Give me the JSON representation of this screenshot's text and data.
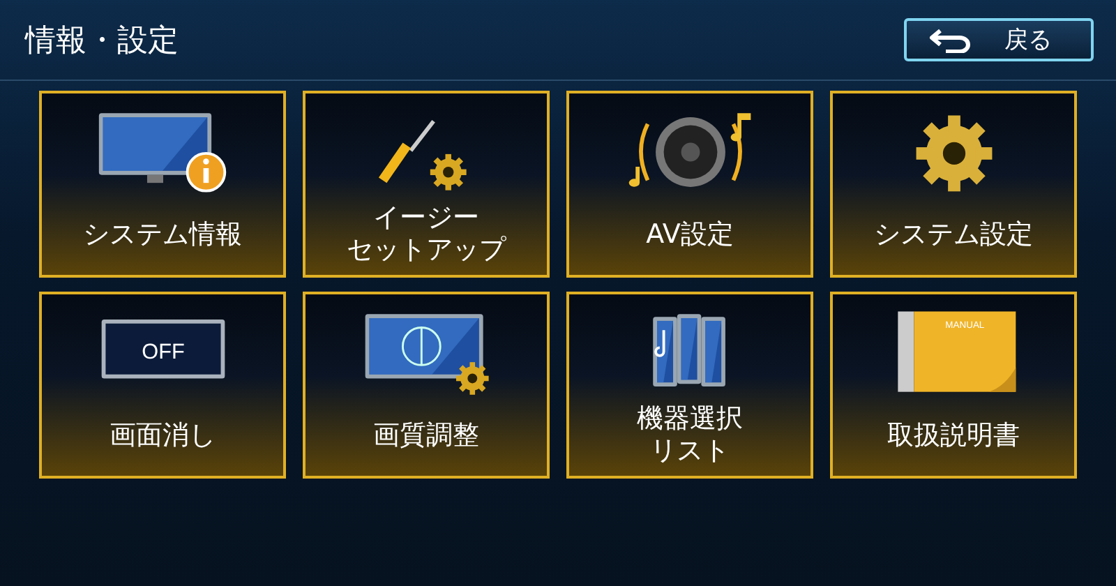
{
  "title": "情報・設定",
  "back_button": {
    "label": "戻る"
  },
  "tiles": [
    {
      "kind": "display-info",
      "label": "システム情報"
    },
    {
      "kind": "tools",
      "label": [
        "イージー",
        "セットアップ"
      ]
    },
    {
      "kind": "speaker",
      "label": "AV設定"
    },
    {
      "kind": "gear",
      "label": "システム設定"
    },
    {
      "kind": "display-off",
      "label": "画面消し",
      "icon_text": "OFF"
    },
    {
      "kind": "display-gear",
      "label": "画質調整"
    },
    {
      "kind": "devices",
      "label": [
        "機器選択",
        "リスト"
      ]
    },
    {
      "kind": "manual",
      "label": "取扱説明書",
      "icon_text": "MANUAL"
    }
  ]
}
